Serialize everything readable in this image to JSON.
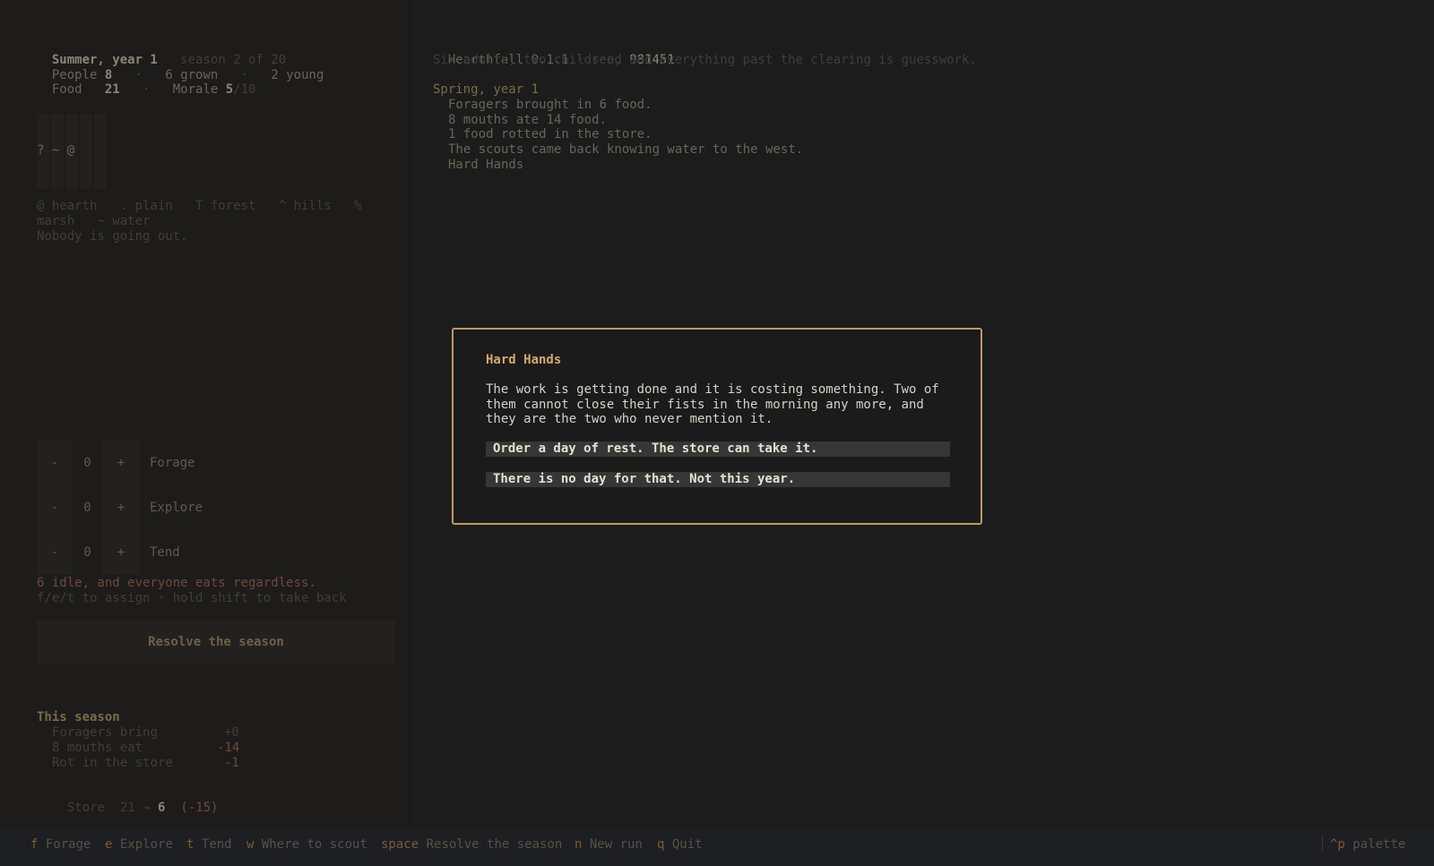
{
  "status": {
    "season_line": "Summer, year 1",
    "season_sub": "season 2 of 20",
    "people_label": "People",
    "people_count": "8",
    "people_sep1": "·",
    "grown": "6 grown",
    "people_sep2": "·",
    "young": "2 young",
    "food_label": "Food",
    "food_value": "21",
    "food_sep": "·",
    "morale_label": "Morale",
    "morale_value": "5",
    "morale_max": "/10"
  },
  "map": {
    "row_text": "? ~ @",
    "legend_line1": "@ hearth   . plain   T forest   ^ hills   %",
    "legend_line2": "marsh   ~ water",
    "status": "Nobody is going out."
  },
  "assign": {
    "rows": [
      {
        "minus": "-",
        "value": "0",
        "plus": "+",
        "label": "Forage"
      },
      {
        "minus": "-",
        "value": "0",
        "plus": "+",
        "label": "Explore"
      },
      {
        "minus": "-",
        "value": "0",
        "plus": "+",
        "label": "Tend"
      }
    ],
    "idle_note": "6 idle, and everyone eats regardless.",
    "hint": "f/e/t to assign · hold shift to take back",
    "resolve_label": "Resolve the season"
  },
  "summary": {
    "title": "This season",
    "lines": [
      {
        "label": "Foragers bring",
        "value": "+0"
      },
      {
        "label": "8 mouths eat",
        "value": "-14"
      },
      {
        "label": "Rot in the store",
        "value": "-1"
      }
    ],
    "store_label": "Store",
    "store_from": "21",
    "store_arrow": "→",
    "store_to": "6",
    "store_delta": "(-15)"
  },
  "log": {
    "app_name": "Hearthfall",
    "version": "0.1.1",
    "sep": "·",
    "seed_label": "seed",
    "seed_value": "981451",
    "intro": "Six adults, two children, and everything past the clearing is guesswork.",
    "entry_title": "Spring, year 1",
    "entry_lines": [
      "Foragers brought in 6 food.",
      "8 mouths ate 14 food.",
      "1 food rotted in the store.",
      "The scouts came back knowing water to the west.",
      "Hard Hands"
    ]
  },
  "modal": {
    "title": "Hard Hands",
    "body": "The work is getting done and it is costing something. Two of them cannot close their fists in the morning any more, and they are the two who never mention it.",
    "option1": "Order a day of rest. The store can take it.",
    "option2": "There is no day for that. Not this year."
  },
  "bottombar": {
    "hints": [
      {
        "key": "f",
        "label": "Forage"
      },
      {
        "key": "e",
        "label": "Explore"
      },
      {
        "key": "t",
        "label": "Tend"
      },
      {
        "key": "w",
        "label": "Where to scout"
      },
      {
        "key": "space",
        "label": "Resolve the season"
      },
      {
        "key": "n",
        "label": "New run"
      },
      {
        "key": "q",
        "label": "Quit"
      }
    ],
    "palette_key": "^p",
    "palette_label": "palette"
  },
  "colors": {
    "accent_gold": "#d7a86b",
    "modal_border": "#b89b62",
    "key_hint": "#7a5a35",
    "background": "#1c1c1c"
  }
}
